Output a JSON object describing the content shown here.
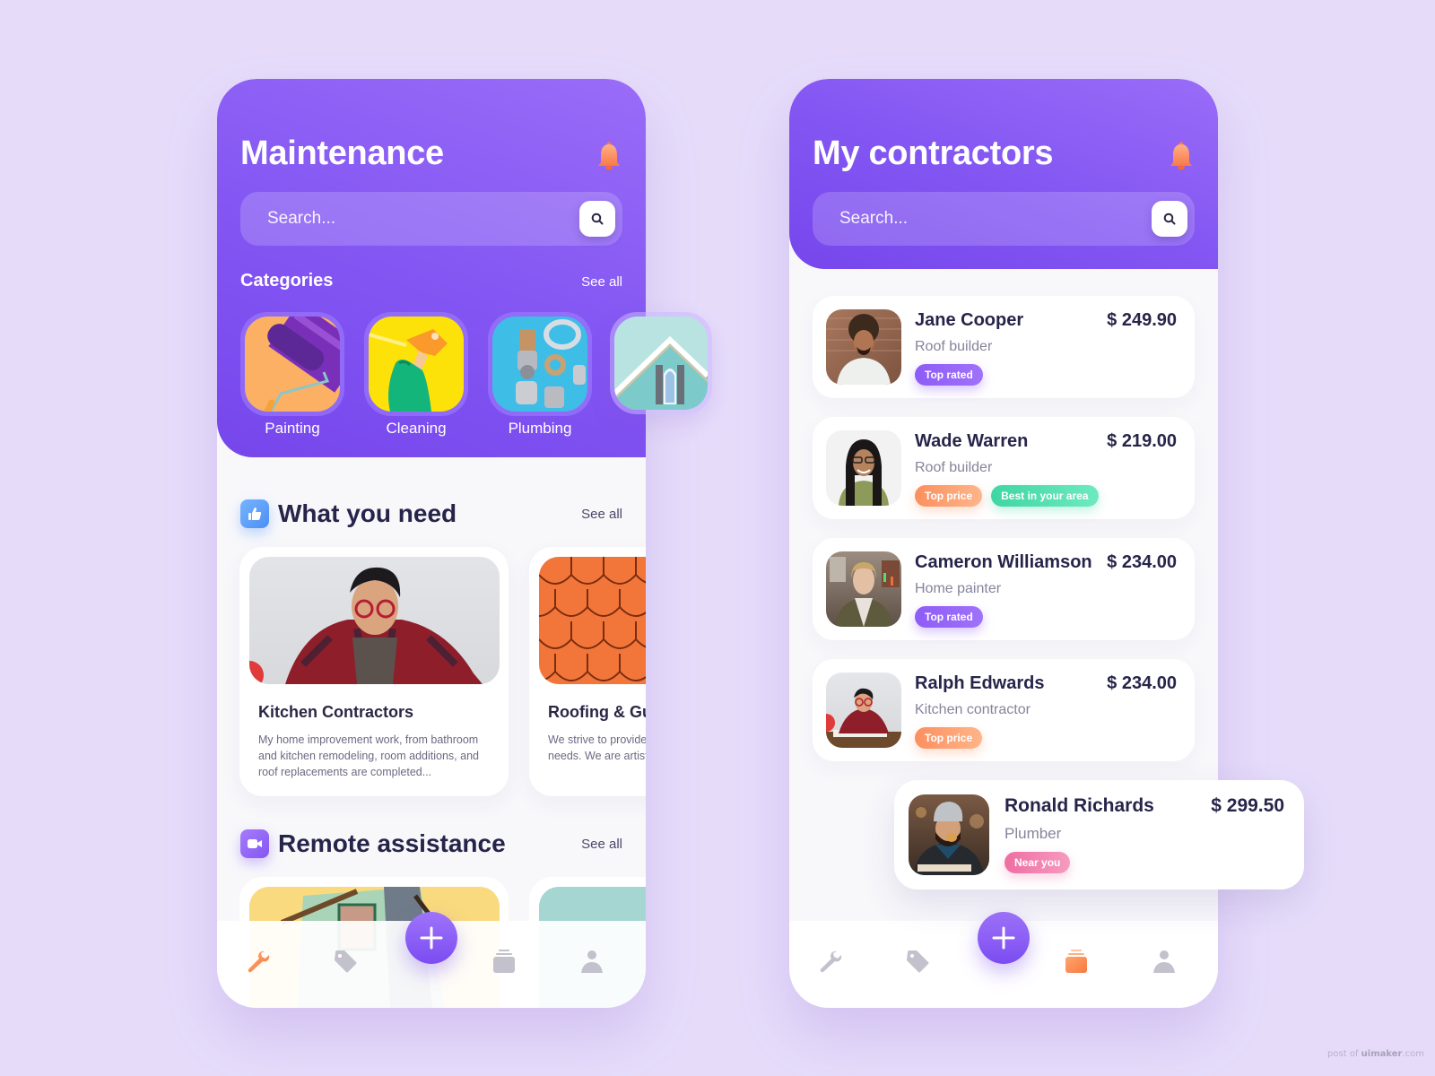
{
  "colors": {
    "background": "#e6dcfa",
    "accent_purple": "#8457f3",
    "accent_orange": "#fb8f5e",
    "badge_green": "#3fd6a4",
    "badge_pink": "#ee6ea2",
    "nav_inactive": "#c2c1cc",
    "text_dark": "#27244a"
  },
  "maintenance": {
    "title": "Maintenance",
    "bell_icon": "bell-icon",
    "search": {
      "placeholder": "Search...",
      "icon": "search-icon"
    },
    "categories": {
      "label": "Categories",
      "see_all": "See all",
      "items": [
        {
          "label": "Painting",
          "image": "paint-roller"
        },
        {
          "label": "Cleaning",
          "image": "spray-bottle-glove"
        },
        {
          "label": "Plumbing",
          "image": "pipe-fittings"
        },
        {
          "label": "",
          "image": "house-roof-window"
        }
      ]
    },
    "what_you_need": {
      "title": "What you need",
      "icon": "thumbs-up-icon",
      "see_all": "See all",
      "cards": [
        {
          "title": "Kitchen Contractors",
          "description": "My home improvement work, from bathroom and kitchen remodeling, room additions, and roof replacements are completed...",
          "image": "man-drafting-plans"
        },
        {
          "title": "Roofing & Gutters",
          "description": "We strive to provide service for all of your needs. We are artists",
          "image": "orange-roof-tiles"
        }
      ]
    },
    "remote_assistance": {
      "title": "Remote assistance",
      "icon": "video-camera-icon",
      "see_all": "See all"
    },
    "nav": {
      "items": [
        {
          "name": "tools",
          "icon": "wrench-icon",
          "active": true
        },
        {
          "name": "deals",
          "icon": "tag-icon",
          "active": false
        },
        {
          "name": "add",
          "icon": "plus-icon",
          "active": false
        },
        {
          "name": "orders",
          "icon": "stack-icon",
          "active": false
        },
        {
          "name": "profile",
          "icon": "user-icon",
          "active": false
        }
      ]
    }
  },
  "contractors": {
    "title": "My contractors",
    "bell_icon": "bell-icon",
    "search": {
      "placeholder": "Search...",
      "icon": "search-icon"
    },
    "list": [
      {
        "name": "Jane Cooper",
        "role": "Roof builder",
        "price": "$ 249.90",
        "badges": [
          {
            "label": "Top rated",
            "type": "purple"
          }
        ]
      },
      {
        "name": "Wade Warren",
        "role": "Roof builder",
        "price": "$ 219.00",
        "badges": [
          {
            "label": "Top price",
            "type": "orange"
          },
          {
            "label": "Best in your area",
            "type": "green"
          }
        ]
      },
      {
        "name": "Cameron Williamson",
        "role": "Home painter",
        "price": "$ 234.00",
        "badges": [
          {
            "label": "Top rated",
            "type": "purple"
          }
        ]
      },
      {
        "name": "Ralph Edwards",
        "role": "Kitchen contractor",
        "price": "$ 234.00",
        "badges": [
          {
            "label": "Top price",
            "type": "orange"
          }
        ]
      }
    ],
    "highlighted": {
      "name": "Ronald Richards",
      "role": "Plumber",
      "price": "$ 299.50",
      "badges": [
        {
          "label": "Near you",
          "type": "pink"
        }
      ]
    },
    "nav": {
      "items": [
        {
          "name": "tools",
          "icon": "wrench-icon",
          "active": false
        },
        {
          "name": "deals",
          "icon": "tag-icon",
          "active": false
        },
        {
          "name": "add",
          "icon": "plus-icon",
          "active": false
        },
        {
          "name": "orders",
          "icon": "stack-icon",
          "active": true
        },
        {
          "name": "profile",
          "icon": "user-icon",
          "active": false
        }
      ]
    }
  },
  "watermark": {
    "prefix": "post of ",
    "brand": "uimaker",
    "suffix": ".com"
  }
}
